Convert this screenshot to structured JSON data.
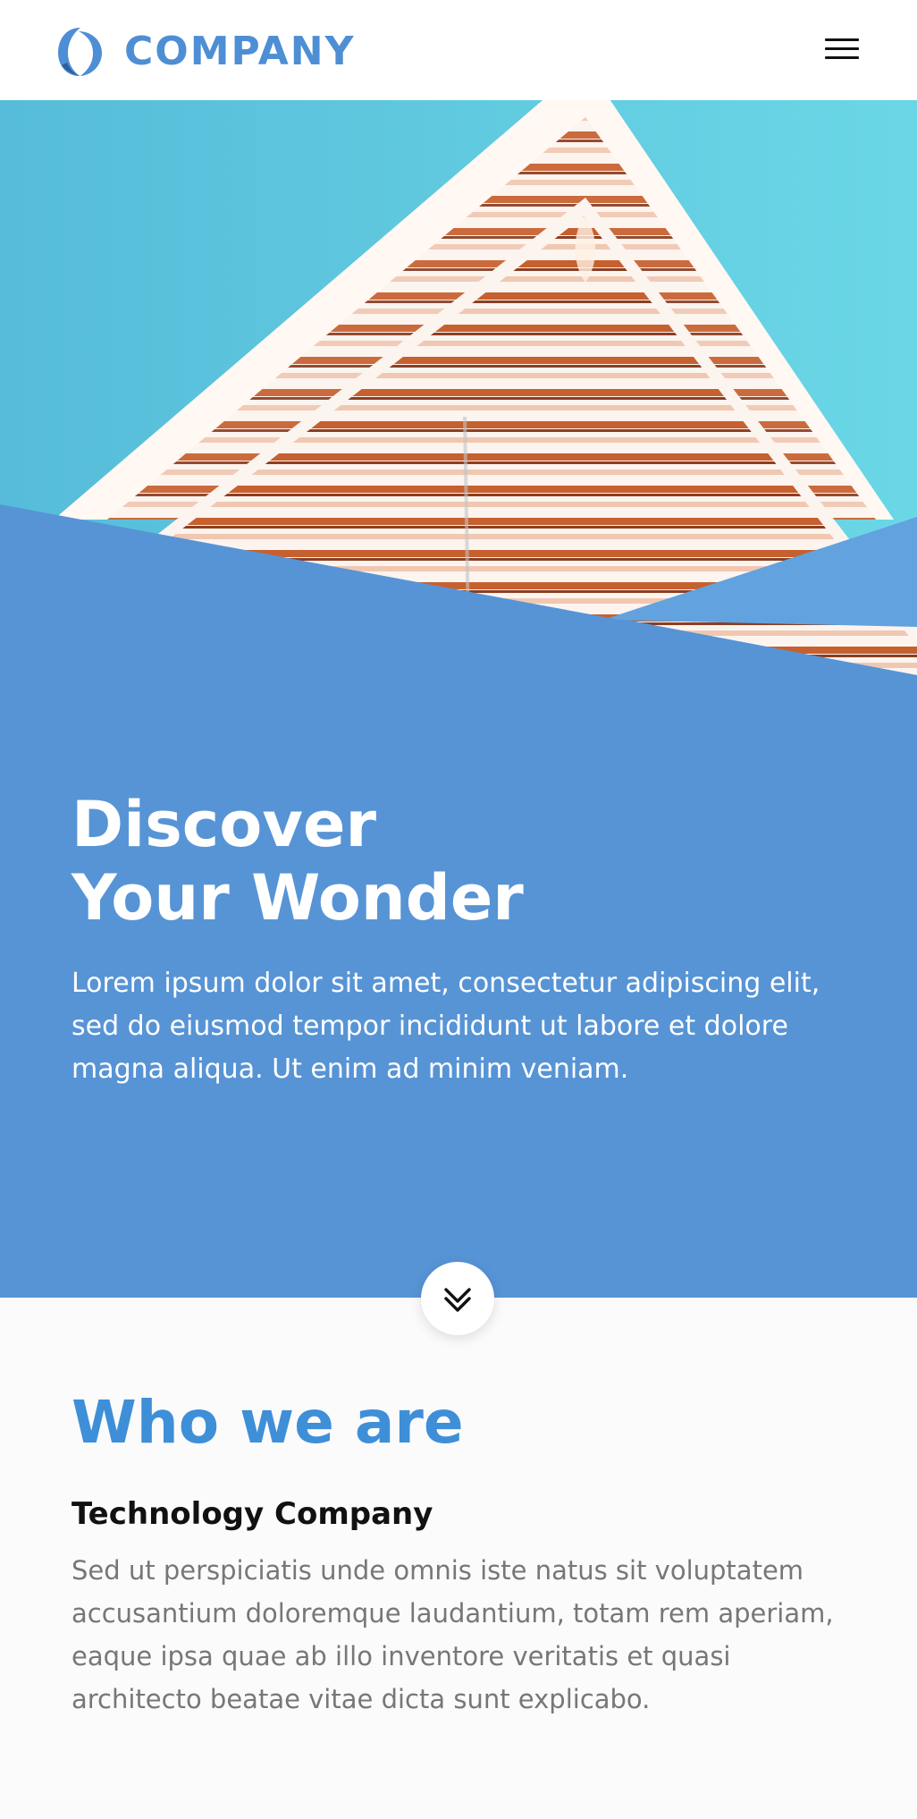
{
  "colors": {
    "brand": "#4e8ed4",
    "hero_background": "#5794d5",
    "accent_heading": "#3e8fd8",
    "body_text_muted": "#777777",
    "sky": "#5ac8df"
  },
  "header": {
    "brand_name": "COMPANY",
    "logo_icon": "brand-swirl-logo",
    "menu_icon": "hamburger-menu-icon"
  },
  "hero": {
    "title_line_1": "Discover",
    "title_line_2": "Your Wonder",
    "description": "Lorem ipsum dolor sit amet, consectetur adipiscing elit, sed do eiusmod tempor incididunt ut labore et dolore magna aliqua. Ut enim ad minim veniam.",
    "image_subject": "building-facade-photo",
    "scroll_icon": "double-chevron-down-icon"
  },
  "about": {
    "title": "Who we are",
    "subtitle": "Technology Company",
    "description": "Sed ut perspiciatis unde omnis iste natus sit voluptatem accusantium doloremque laudantium, totam rem aperiam, eaque ipsa quae ab illo inventore veritatis et quasi architecto beatae vitae dicta sunt explicabo."
  }
}
